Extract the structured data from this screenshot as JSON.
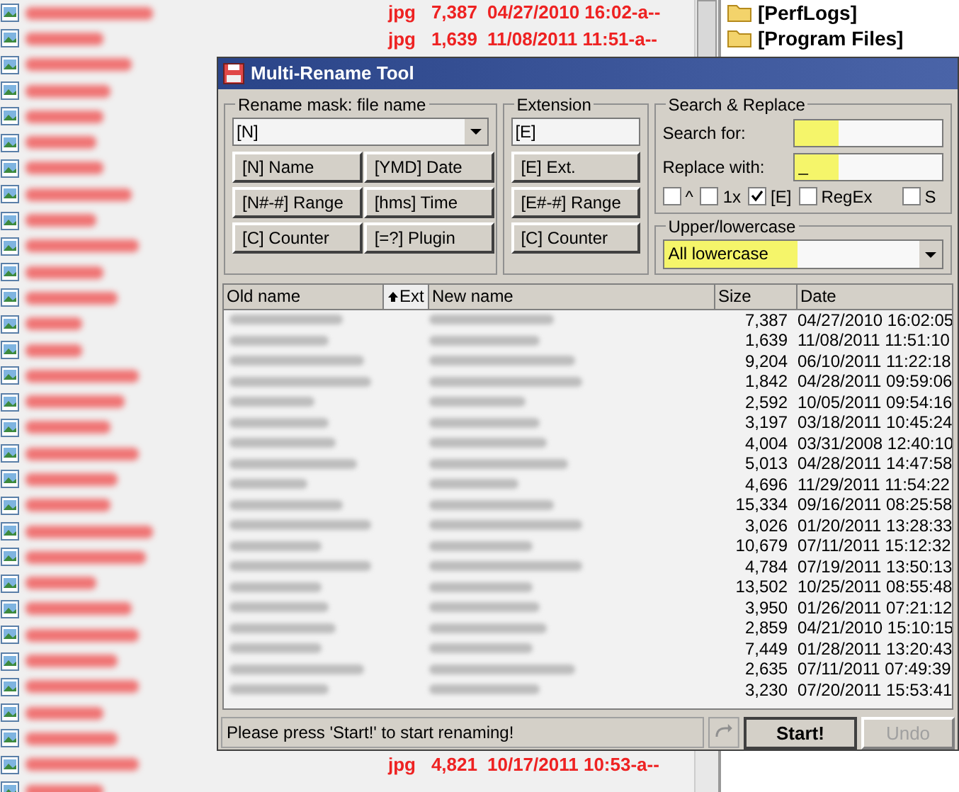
{
  "background": {
    "top_rows": [
      {
        "ext": "jpg",
        "size": "7,387",
        "date": "04/27/2010 16:02-a--"
      },
      {
        "ext": "jpg",
        "size": "1,639",
        "date": "11/08/2011 11:51-a--"
      }
    ],
    "bottom_rows": [
      {
        "ext": "jpg",
        "size": "4,821",
        "date": "10/17/2011 10:53-a--"
      }
    ],
    "folders": [
      "[PerfLogs]",
      "[Program Files]"
    ]
  },
  "dialog": {
    "title": "Multi-Rename Tool",
    "mask": {
      "legend": "Rename mask: file name",
      "value": "[N]",
      "buttons": [
        "[N]  Name",
        "[YMD]  Date",
        "[N#-#] Range",
        "[hms]  Time",
        "[C]  Counter",
        "[=?]  Plugin"
      ]
    },
    "extension": {
      "legend": "Extension",
      "value": "[E]",
      "buttons": [
        "[E]  Ext.",
        "[E#-#] Range",
        "[C]  Counter"
      ]
    },
    "search_replace": {
      "legend": "Search & Replace",
      "search_label": "Search for:",
      "replace_label": "Replace with:",
      "replace_value": "_",
      "options": [
        {
          "label": "^",
          "checked": false
        },
        {
          "label": "1x",
          "checked": false
        },
        {
          "label": "[E]",
          "checked": true
        },
        {
          "label": "RegEx",
          "checked": false
        },
        {
          "label": "S",
          "checked": false
        }
      ]
    },
    "case": {
      "legend": "Upper/lowercase",
      "value": "All lowercase"
    },
    "columns": [
      "Old name",
      "Ext",
      "New name",
      "Size",
      "Date"
    ],
    "rows": [
      {
        "size": "7,387",
        "date": "04/27/2010 16:02:05"
      },
      {
        "size": "1,639",
        "date": "11/08/2011 11:51:10"
      },
      {
        "size": "9,204",
        "date": "06/10/2011 11:22:18"
      },
      {
        "size": "1,842",
        "date": "04/28/2011 09:59:06"
      },
      {
        "size": "2,592",
        "date": "10/05/2011 09:54:16"
      },
      {
        "size": "3,197",
        "date": "03/18/2011 10:45:24"
      },
      {
        "size": "4,004",
        "date": "03/31/2008 12:40:10"
      },
      {
        "size": "5,013",
        "date": "04/28/2011 14:47:58"
      },
      {
        "size": "4,696",
        "date": "11/29/2011 11:54:22"
      },
      {
        "size": "15,334",
        "date": "09/16/2011 08:25:58"
      },
      {
        "size": "3,026",
        "date": "01/20/2011 13:28:33"
      },
      {
        "size": "10,679",
        "date": "07/11/2011 15:12:32"
      },
      {
        "size": "4,784",
        "date": "07/19/2011 13:50:13"
      },
      {
        "size": "13,502",
        "date": "10/25/2011 08:55:48"
      },
      {
        "size": "3,950",
        "date": "01/26/2011 07:21:12"
      },
      {
        "size": "2,859",
        "date": "04/21/2010 15:10:15"
      },
      {
        "size": "7,449",
        "date": "01/28/2011 13:20:43"
      },
      {
        "size": "2,635",
        "date": "07/11/2011 07:49:39"
      },
      {
        "size": "3,230",
        "date": "07/20/2011 15:53:41"
      }
    ],
    "status": "Please press 'Start!' to start renaming!",
    "start_button": "Start!",
    "undo_button": "Undo",
    "undo_disabled": true
  }
}
